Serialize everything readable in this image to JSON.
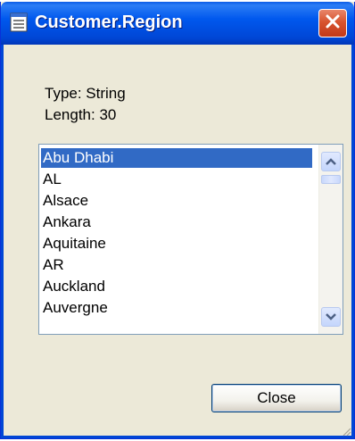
{
  "window": {
    "title": "Customer.Region",
    "title_icon": "table-sheet-icon",
    "close_icon": "close-x-icon",
    "accent": "#0058ee",
    "close_color": "#d8542f"
  },
  "info": {
    "type_line": "Type: String",
    "length_line": "Length: 30"
  },
  "list": {
    "selected_color": "#316ac5",
    "items": [
      {
        "label": "Abu Dhabi",
        "selected": true
      },
      {
        "label": "AL",
        "selected": false
      },
      {
        "label": "Alsace",
        "selected": false
      },
      {
        "label": "Ankara",
        "selected": false
      },
      {
        "label": "Aquitaine",
        "selected": false
      },
      {
        "label": "AR",
        "selected": false
      },
      {
        "label": "Auckland",
        "selected": false
      },
      {
        "label": "Auvergne",
        "selected": false
      }
    ],
    "scroll_up_icon": "chevron-up-icon",
    "scroll_down_icon": "chevron-down-icon"
  },
  "footer": {
    "close_label": "Close"
  }
}
